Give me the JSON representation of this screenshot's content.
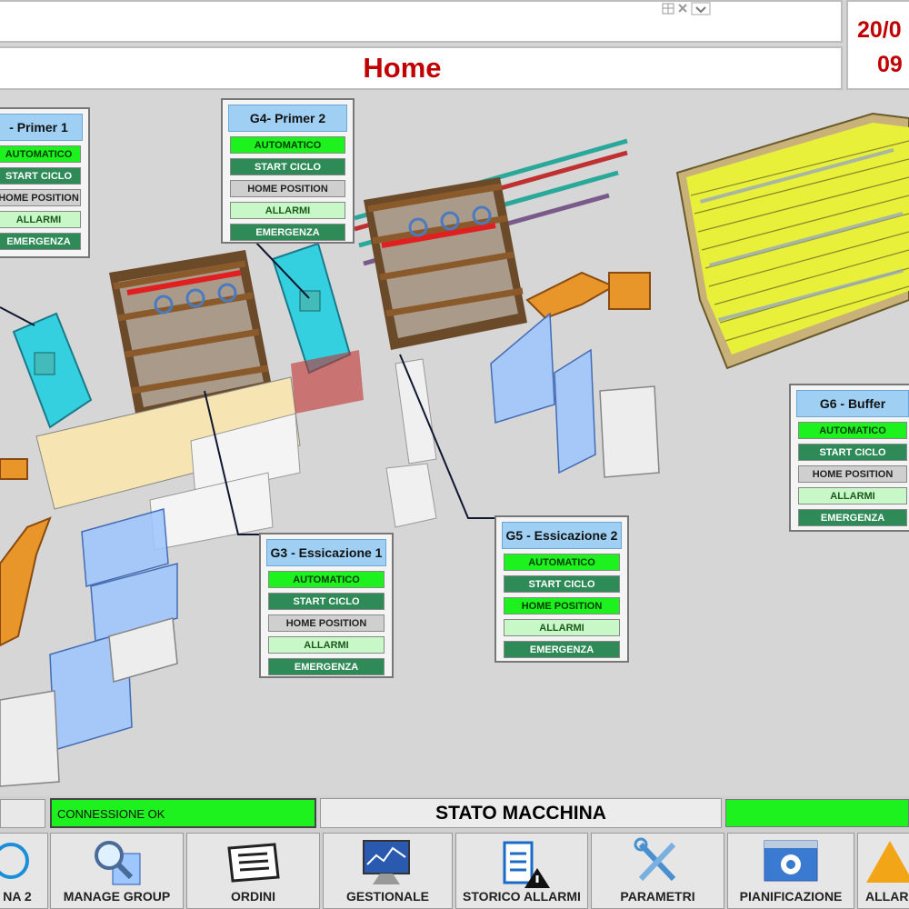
{
  "header": {
    "title": "Home",
    "date_partial": "20/0",
    "time_partial": "09"
  },
  "groups": {
    "g3": {
      "title": "G3 - Essicazione 1",
      "buttons": [
        "AUTOMATICO",
        "START CICLO",
        "HOME POSITION",
        "ALLARMI",
        "EMERGENZA"
      ]
    },
    "g4": {
      "title": "G4- Primer 2",
      "buttons": [
        "AUTOMATICO",
        "START CICLO",
        "HOME POSITION",
        "ALLARMI",
        "EMERGENZA"
      ]
    },
    "g5": {
      "title": "G5 - Essicazione 2",
      "buttons": [
        "AUTOMATICO",
        "START CICLO",
        "HOME POSITION",
        "ALLARMI",
        "EMERGENZA"
      ]
    },
    "g6": {
      "title": "G6 - Buffer",
      "buttons": [
        "AUTOMATICO",
        "START CICLO",
        "HOME POSITION",
        "ALLARMI",
        "EMERGENZA"
      ]
    },
    "g1": {
      "title": "- Primer 1",
      "buttons": [
        "AUTOMATICO",
        "START CICLO",
        "HOME POSITION",
        "ALLARMI",
        "EMERGENZA"
      ]
    }
  },
  "status": {
    "connection": "CONNESSIONE OK",
    "machine_state": "STATO MACCHINA"
  },
  "nav": {
    "items": [
      {
        "label": "NA 2",
        "icon": "info-icon"
      },
      {
        "label": "MANAGE GROUP",
        "icon": "magnifier-icon"
      },
      {
        "label": "ORDINI",
        "icon": "clipboard-list-icon"
      },
      {
        "label": "GESTIONALE",
        "icon": "monitor-chart-icon"
      },
      {
        "label": "STORICO ALLARMI",
        "icon": "checklist-warning-icon"
      },
      {
        "label": "PARAMETRI",
        "icon": "tools-icon"
      },
      {
        "label": "PIANIFICAZIONE",
        "icon": "gear-window-icon"
      },
      {
        "label": "ALLAR",
        "icon": "warning-icon"
      }
    ]
  },
  "colors": {
    "title_red": "#c00000",
    "status_green": "#1ef21e",
    "button_dark_green": "#2e8b57",
    "panel_title_blue": "#9fd0f4"
  }
}
